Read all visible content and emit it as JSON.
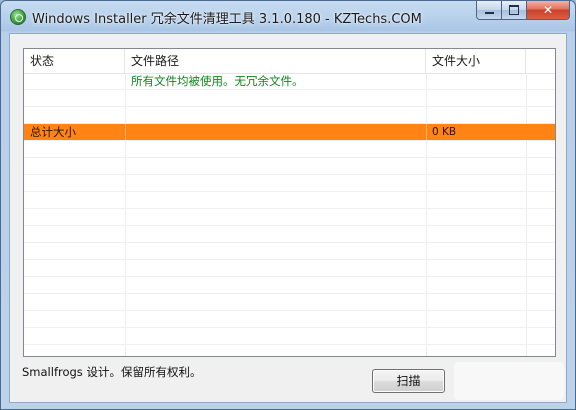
{
  "window": {
    "title": "Windows Installer 冗余文件清理工具 3.1.0.180 - KZTechs.COM",
    "close_glyph": "✕"
  },
  "table": {
    "columns": [
      "状态",
      "文件路径",
      "文件大小",
      ""
    ],
    "message_row": {
      "status": "",
      "path": "所有文件均被使用。无冗余文件。",
      "size": ""
    },
    "total_row": {
      "label": "总计大小",
      "path": "",
      "size": "0 KB"
    }
  },
  "footer": {
    "credits": "Smallfrogs 设计。保留所有权利。",
    "scan_label": "扫描"
  },
  "colors": {
    "total_row_bg": "#ff8414",
    "message_text": "#11861c"
  }
}
